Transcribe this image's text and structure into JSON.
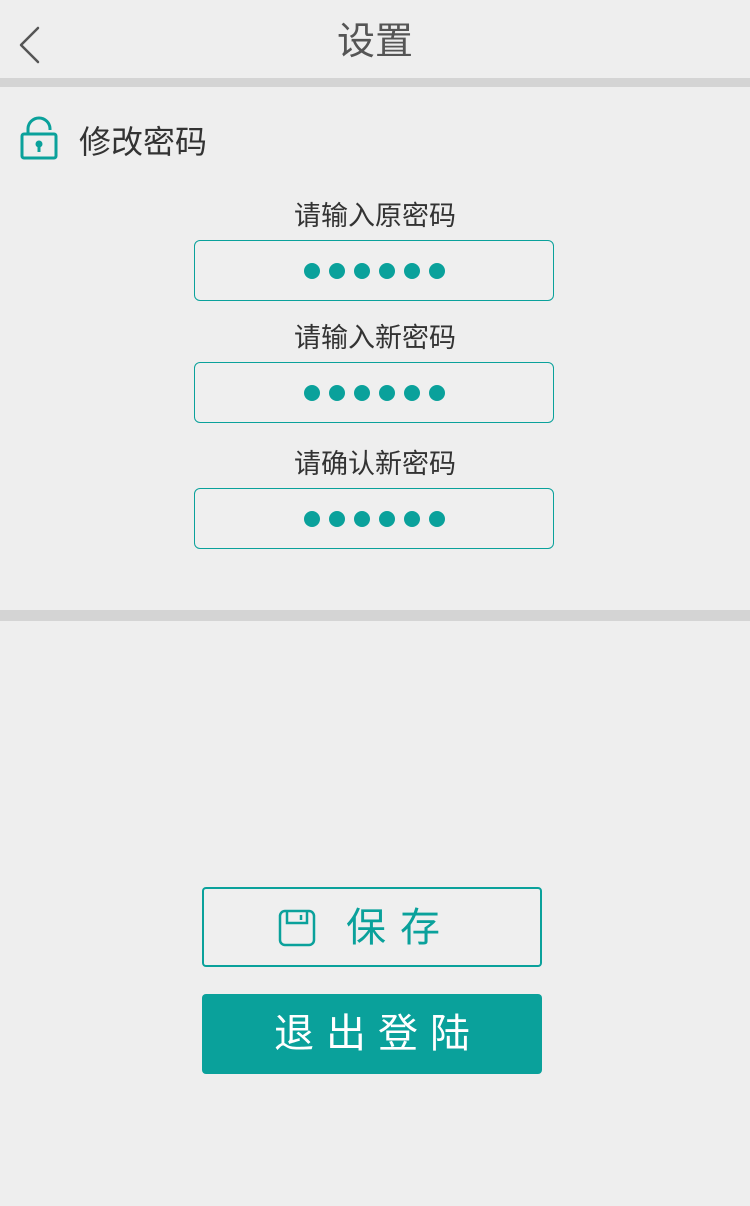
{
  "header": {
    "title": "设置",
    "back_icon": "chevron-left-icon"
  },
  "section": {
    "title": "修改密码",
    "icon": "lock-icon"
  },
  "fields": [
    {
      "label": "请输入原密码",
      "masked_length": 6
    },
    {
      "label": "请输入新密码",
      "masked_length": 6
    },
    {
      "label": "请确认新密码",
      "masked_length": 6
    }
  ],
  "buttons": {
    "save_label": "保存",
    "save_icon": "floppy-disk-icon",
    "logout_label": "退出登陆"
  },
  "colors": {
    "accent": "#0aa19b",
    "background": "#eeeeee",
    "divider": "#d4d4d4"
  }
}
